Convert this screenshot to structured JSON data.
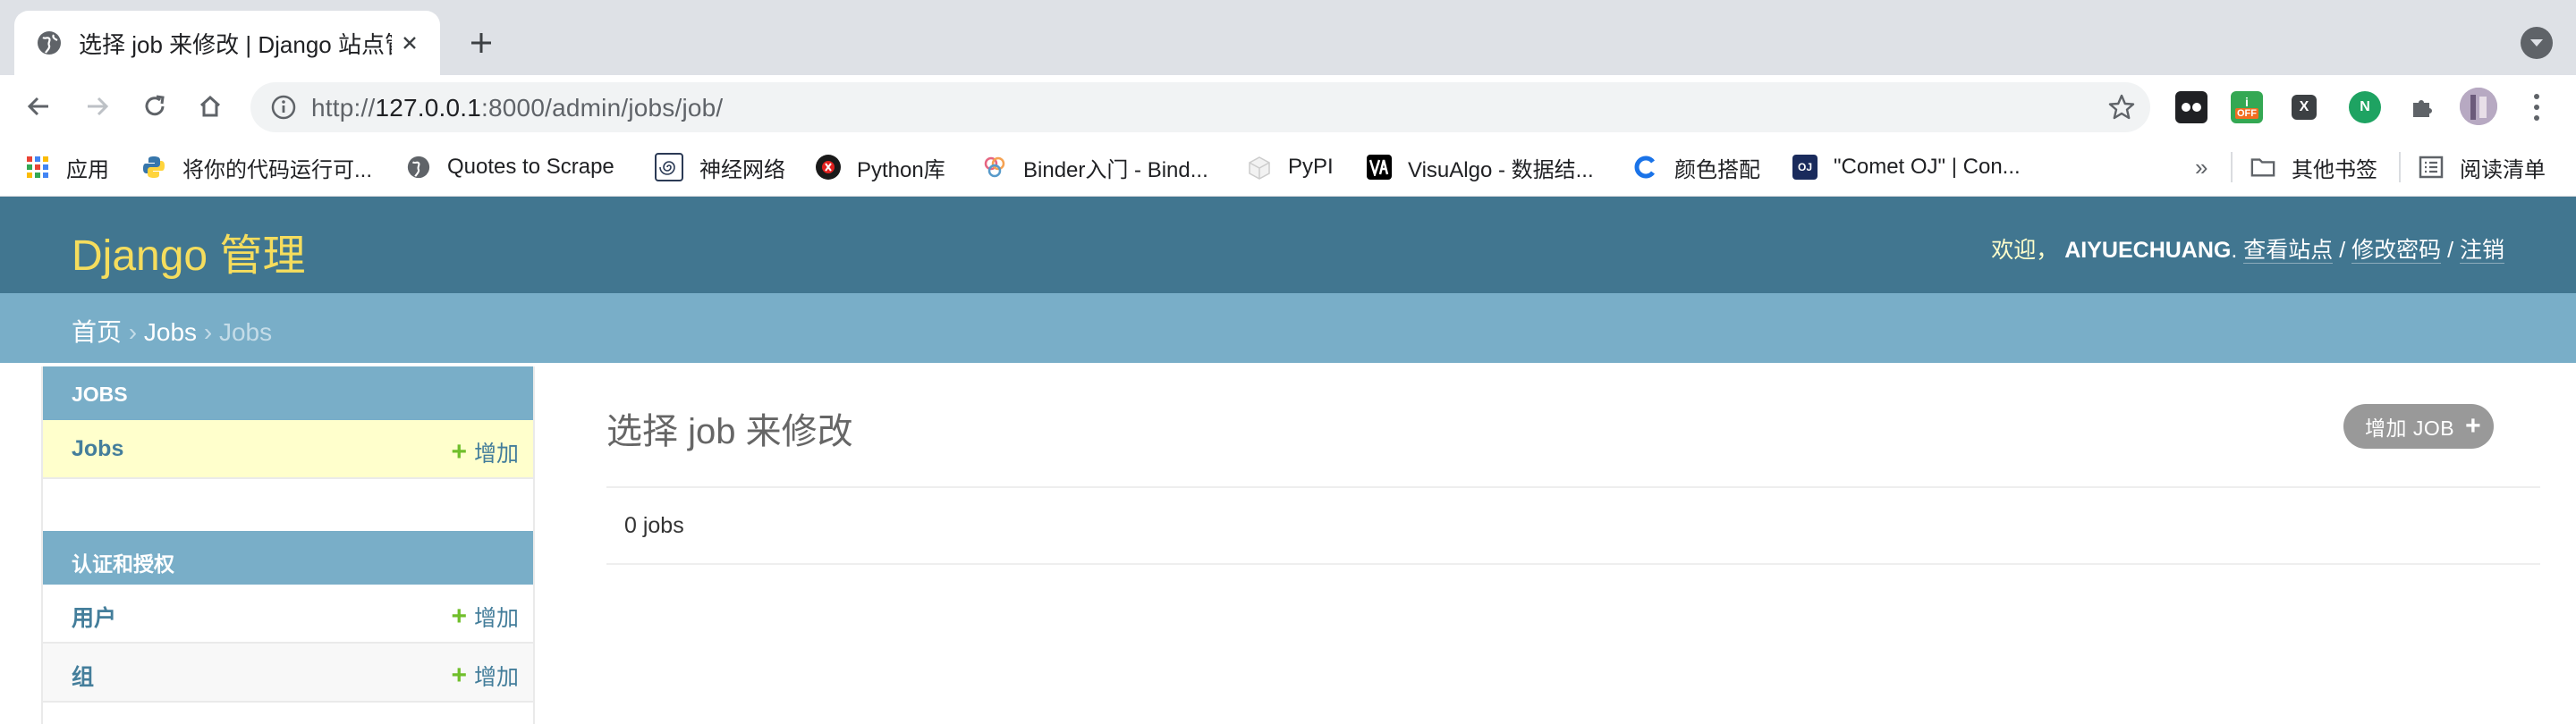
{
  "browser": {
    "tab_title": "选择 job 来修改 | Django 站点管",
    "url_prefix": "http://",
    "url_host": "127.0.0.1",
    "url_rest": ":8000/admin/jobs/job/",
    "extensions": [
      {
        "name": "extension-icon-1",
        "color": "#202124",
        "text": ""
      },
      {
        "name": "extension-icon-2",
        "color": "#34a853",
        "text": "OFF"
      },
      {
        "name": "extension-icon-3",
        "color": "#3c4043",
        "text": "X"
      },
      {
        "name": "extension-icon-4",
        "color": "#1ea362",
        "text": "N"
      }
    ],
    "bookmarks": [
      {
        "label": "应用",
        "icon": "apps-grid-icon"
      },
      {
        "label": "将你的代码运行可...",
        "icon": "python-icon"
      },
      {
        "label": "Quotes to Scrape",
        "icon": "globe-icon"
      },
      {
        "label": "神经网络",
        "icon": "spiral-icon"
      },
      {
        "label": "Python库",
        "icon": "red-circle-icon"
      },
      {
        "label": "Binder入门 - Bind...",
        "icon": "binder-icon"
      },
      {
        "label": "PyPI",
        "icon": "pypi-cube-icon"
      },
      {
        "label": "VisuAlgo - 数据结...",
        "icon": "visualgo-icon"
      },
      {
        "label": "颜色搭配",
        "icon": "color-c-icon"
      },
      {
        "label": "\"Comet OJ\" | Con...",
        "icon": "oj-icon"
      }
    ],
    "overflow": "»",
    "other_bookmarks": "其他书签",
    "reading_list": "阅读清单"
  },
  "header": {
    "brand": "Django 管理",
    "welcome": "欢迎，",
    "username": "AIYUECHUANG",
    "period": ".",
    "view_site": "查看站点",
    "change_password": "修改密码",
    "logout": "注销",
    "slash": " / "
  },
  "breadcrumbs": {
    "home": "首页",
    "arrow": " › ",
    "app": "Jobs",
    "current": "Jobs"
  },
  "sidebar": {
    "modules": [
      {
        "caption": "JOBS",
        "rows": [
          {
            "label": "Jobs",
            "add": "增加"
          }
        ]
      },
      {
        "caption": "认证和授权",
        "rows": [
          {
            "label": "用户",
            "add": "增加"
          },
          {
            "label": "组",
            "add": "增加"
          }
        ]
      }
    ]
  },
  "main": {
    "title": "选择 job 来修改",
    "add_button": "增加 JOB",
    "result_count": "0 jobs"
  },
  "colors": {
    "header_bg": "#417690",
    "brand": "#f5dd5d",
    "breadcrumb_bg": "#79aec8",
    "link": "#447e9b",
    "add_green": "#70bf2b",
    "active_row": "#ffffcc"
  }
}
